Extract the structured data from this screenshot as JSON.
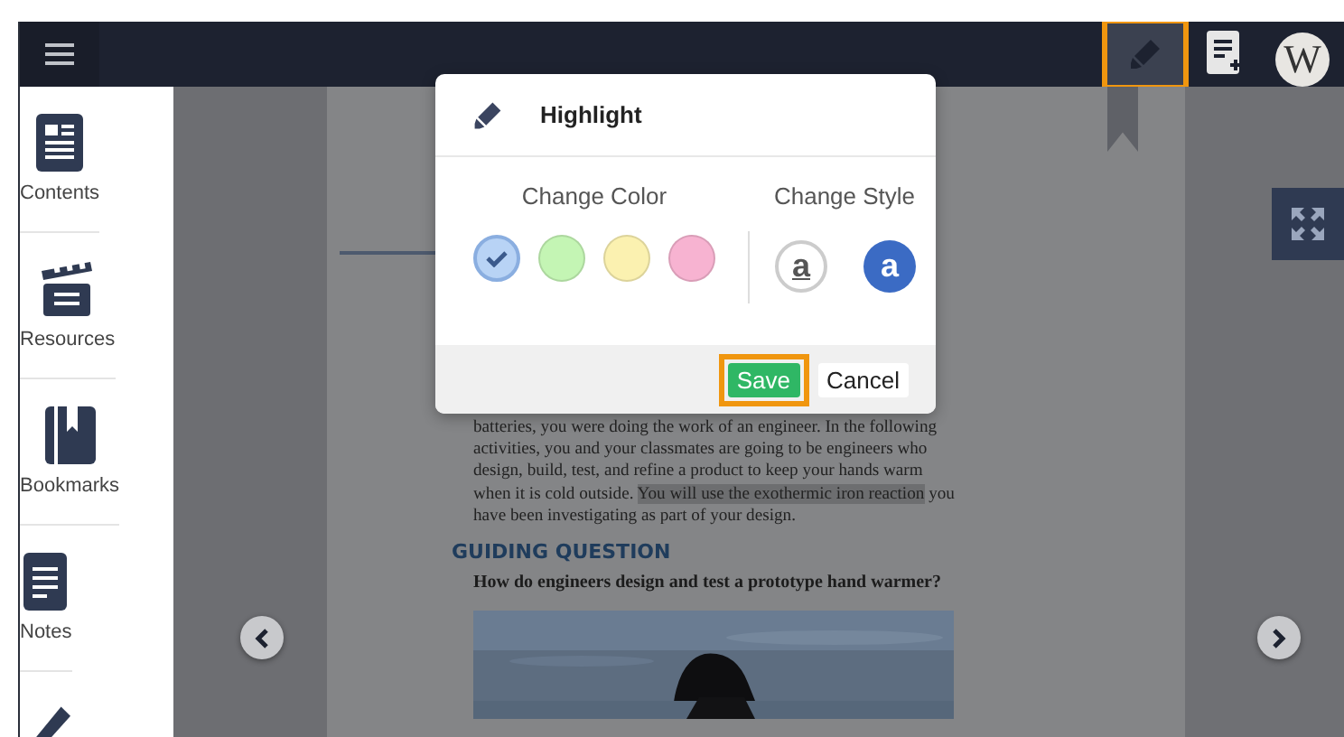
{
  "topbar": {
    "highlighter": {
      "annotated": true
    },
    "avatar": "W"
  },
  "sidebar": {
    "items": [
      {
        "kind": "labeled",
        "label": "Contents"
      },
      {
        "kind": "labeled",
        "label": "Resources"
      },
      {
        "kind": "labeled",
        "label": "Bookmarks"
      },
      {
        "kind": "labeled",
        "label": "Notes"
      },
      {
        "kind": "icon"
      }
    ]
  },
  "page": {
    "paragraph_lines": [
      [
        {
          "text": "batteries, you were doing the work of an engineer. In the following",
          "highlighted": false
        }
      ],
      [
        {
          "text": "activities, you and your classmates are going to be engineers who",
          "highlighted": false
        }
      ],
      [
        {
          "text": "design, build, test, and refine a product to keep your hands warm",
          "highlighted": false
        }
      ],
      [
        {
          "text": "when it is cold outside. ",
          "highlighted": false
        },
        {
          "text": "You will use the exothermic iron reaction",
          "highlighted": true
        },
        {
          "text": " you",
          "highlighted": false
        }
      ],
      [
        {
          "text": "have been investigating as part of your design.",
          "highlighted": false
        }
      ]
    ],
    "heading": "GUIDING QUESTION",
    "question": "How do engineers design and test a prototype hand warmer?",
    "picture": {
      "kind": "picture"
    }
  },
  "dialog": {
    "title": "Highlight",
    "color_heading": "Change Color",
    "style_heading": "Change Style",
    "colors": [
      {
        "color": "#b8d3f5",
        "selected": true
      },
      {
        "color": "#c4f5b4",
        "selected": false
      },
      {
        "color": "#fbf1b0",
        "selected": false
      },
      {
        "color": "#f7b3d1",
        "selected": false
      }
    ],
    "styles": [
      {
        "kind": "underline",
        "label": "a"
      },
      {
        "kind": "filled",
        "label": "a"
      }
    ],
    "buttons": [
      {
        "kind": "primary",
        "label": "Save",
        "annotated": true
      },
      {
        "kind": "secondary",
        "label": "Cancel",
        "annotated": false
      }
    ]
  }
}
